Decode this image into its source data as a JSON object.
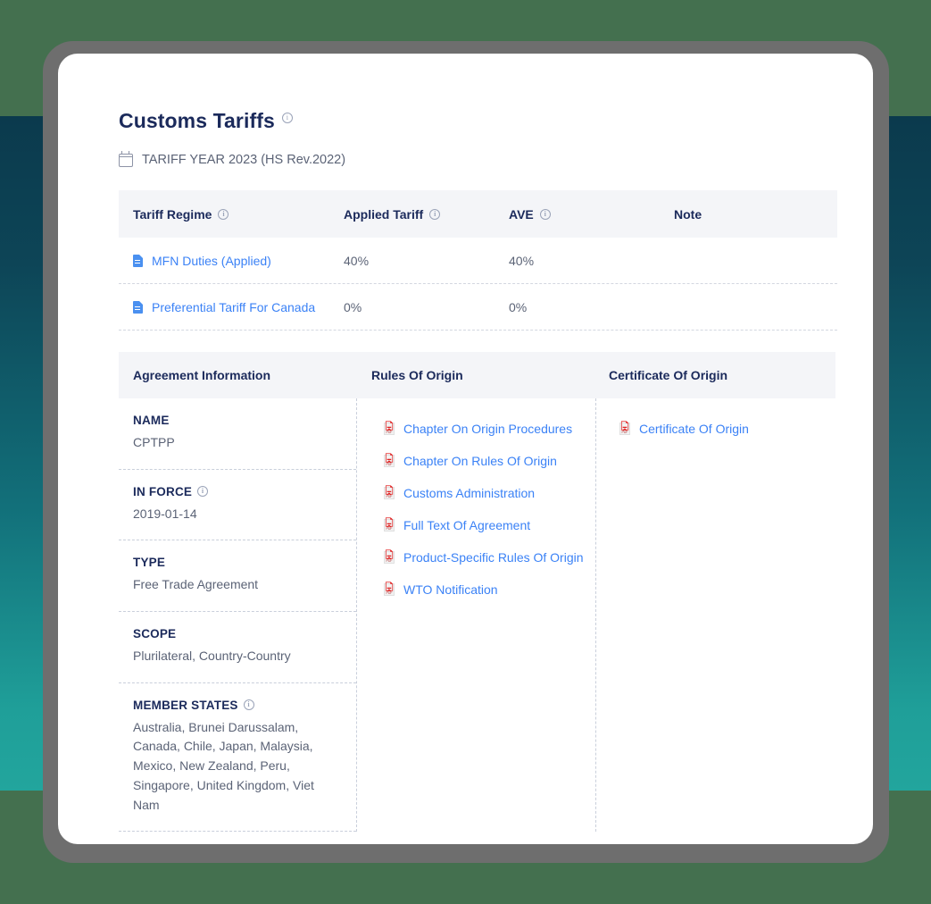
{
  "page": {
    "title": "Customs Tariffs",
    "title_info_icon": "info-icon",
    "subtitle": "TARIFF YEAR 2023 (HS Rev.2022)",
    "calendar_icon": "calendar-icon"
  },
  "tariff_table": {
    "headers": {
      "regime": "Tariff Regime",
      "applied": "Applied Tariff",
      "ave": "AVE",
      "note": "Note"
    },
    "rows": [
      {
        "regime": "MFN Duties (Applied)",
        "applied": "40%",
        "ave": "40%",
        "note": ""
      },
      {
        "regime": "Preferential Tariff For Canada",
        "applied": "0%",
        "ave": "0%",
        "note": ""
      }
    ]
  },
  "agreement": {
    "headers": {
      "info": "Agreement Information",
      "rules": "Rules Of Origin",
      "certificate": "Certificate Of Origin"
    },
    "fields": [
      {
        "label": "NAME",
        "value": "CPTPP",
        "has_info": false
      },
      {
        "label": "IN FORCE",
        "value": "2019-01-14",
        "has_info": true
      },
      {
        "label": "TYPE",
        "value": "Free Trade Agreement",
        "has_info": false
      },
      {
        "label": "SCOPE",
        "value": "Plurilateral, Country-Country",
        "has_info": false
      },
      {
        "label": "MEMBER STATES",
        "value": "Australia, Brunei Darussalam, Canada, Chile, Japan, Malaysia, Mexico, New Zealand, Peru, Singapore, United Kingdom, Viet Nam",
        "has_info": true
      }
    ],
    "rules_of_origin": [
      "Chapter On Origin Procedures",
      "Chapter On Rules Of Origin",
      "Customs Administration",
      "Full Text Of Agreement",
      "Product-Specific Rules Of Origin",
      "WTO Notification"
    ],
    "certificate_of_origin": [
      "Certificate Of Origin"
    ]
  },
  "colors": {
    "heading": "#1b2a5b",
    "link": "#3b82f6",
    "pdf_red": "#e02020",
    "header_bg": "#f4f5f8",
    "body_text": "#5b6376",
    "frame": "#6e6e6e",
    "bg_green": "#44704f",
    "teal_top": "#0b3a4d",
    "teal_bottom": "#22a59d"
  }
}
